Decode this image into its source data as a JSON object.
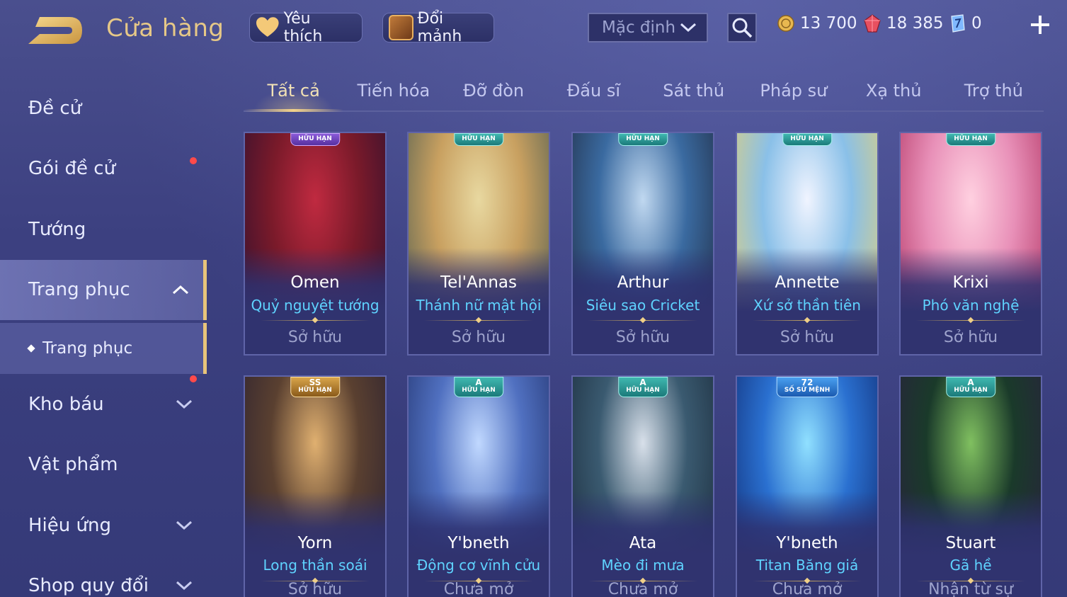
{
  "header": {
    "title": "Cửa hàng",
    "favorites_label": "Yêu thích",
    "exchange_label": "Đổi mảnh",
    "sort_selected": "Mặc định",
    "gold": "13 700",
    "rubies": "18 385",
    "vouchers": "0"
  },
  "sidebar": {
    "items": [
      {
        "label": "Đề cử"
      },
      {
        "label": "Gói đề cử"
      },
      {
        "label": "Tướng"
      },
      {
        "label": "Trang phục"
      },
      {
        "label": "Trang phục"
      },
      {
        "label": "Kho báu"
      },
      {
        "label": "Vật phẩm"
      },
      {
        "label": "Hiệu ứng"
      },
      {
        "label": "Shop quy đổi"
      }
    ]
  },
  "tabs": [
    "Tất cả",
    "Tiến hóa",
    "Đỡ đòn",
    "Đấu sĩ",
    "Sát thủ",
    "Pháp sư",
    "Xạ thủ",
    "Trợ thủ"
  ],
  "cards": [
    {
      "hero": "Omen",
      "skin": "Quỷ nguyệt tướng",
      "status": "Sở hữu",
      "badge": "HỮU HẠN",
      "rank": ""
    },
    {
      "hero": "Tel'Annas",
      "skin": "Thánh nữ mật hội",
      "status": "Sở hữu",
      "badge": "HỮU HẠN",
      "rank": ""
    },
    {
      "hero": "Arthur",
      "skin": "Siêu sao Cricket",
      "status": "Sở hữu",
      "badge": "HỮU HẠN",
      "rank": ""
    },
    {
      "hero": "Annette",
      "skin": "Xứ sở thần tiên",
      "status": "Sở hữu",
      "badge": "HỮU HẠN",
      "rank": ""
    },
    {
      "hero": "Krixi",
      "skin": "Phó văn nghệ",
      "status": "Sở hữu",
      "badge": "HỮU HẠN",
      "rank": ""
    },
    {
      "hero": "Yorn",
      "skin": "Long thần soái",
      "status": "Sở hữu",
      "badge": "HỮU HẠN",
      "rank": "SS"
    },
    {
      "hero": "Y'bneth",
      "skin": "Động cơ vĩnh cửu",
      "status": "Chưa mở",
      "badge": "HỮU HẠN",
      "rank": "A"
    },
    {
      "hero": "Ata",
      "skin": "Mèo đi mưa",
      "status": "Chưa mở",
      "badge": "HỮU HẠN",
      "rank": "A"
    },
    {
      "hero": "Y'bneth",
      "skin": "Titan Băng giá",
      "status": "Chưa mở",
      "badge": "SỐ SỨ MỆNH",
      "rank": "72"
    },
    {
      "hero": "Stuart",
      "skin": "Gã hề",
      "status": "Nhận từ sự",
      "badge": "HỮU HẠN",
      "rank": "A"
    }
  ],
  "colors": {
    "accent_gold": "#e6c887",
    "skin_name": "#5fd3ff",
    "notification": "#ff4a4a"
  }
}
